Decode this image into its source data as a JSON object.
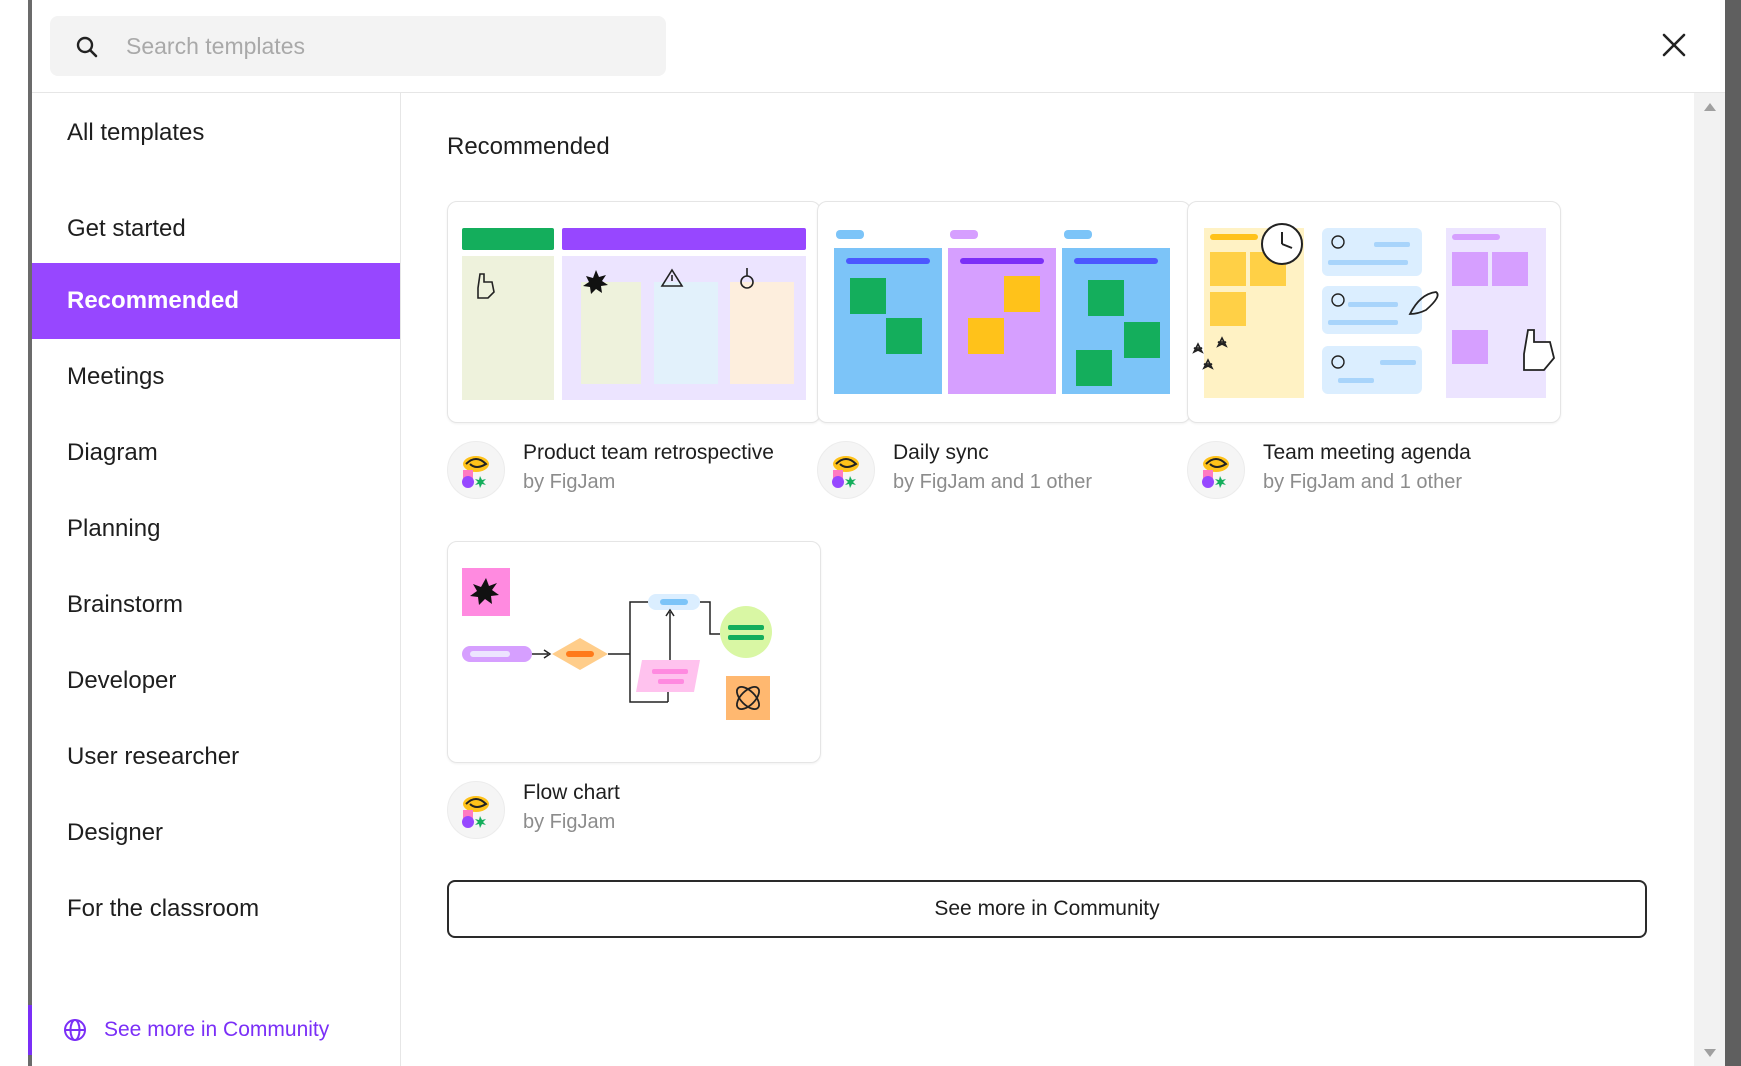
{
  "search": {
    "placeholder": "Search templates"
  },
  "sidebar": {
    "items": [
      {
        "label": "All templates",
        "active": false
      },
      {
        "label": "Get started",
        "active": false
      },
      {
        "label": "Recommended",
        "active": true
      },
      {
        "label": "Meetings",
        "active": false
      },
      {
        "label": "Diagram",
        "active": false
      },
      {
        "label": "Planning",
        "active": false
      },
      {
        "label": "Brainstorm",
        "active": false
      },
      {
        "label": "Developer",
        "active": false
      },
      {
        "label": "User researcher",
        "active": false
      },
      {
        "label": "Designer",
        "active": false
      },
      {
        "label": "For the classroom",
        "active": false
      }
    ],
    "community_link": "See more in Community"
  },
  "main": {
    "section_title": "Recommended",
    "templates": [
      {
        "title": "Product team retrospective",
        "author": "by FigJam"
      },
      {
        "title": "Daily sync",
        "author": "by FigJam and 1 other"
      },
      {
        "title": "Team meeting agenda",
        "author": "by FigJam and 1 other"
      },
      {
        "title": "Flow chart",
        "author": "by FigJam"
      }
    ],
    "see_more_button": "See more in Community"
  },
  "colors": {
    "accent": "#9747ff",
    "link": "#7b2ff7"
  }
}
